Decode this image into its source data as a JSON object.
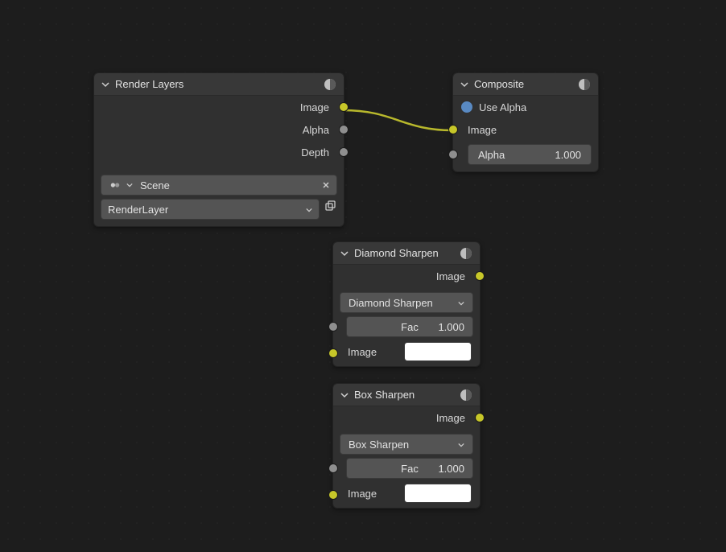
{
  "nodes": {
    "renderLayers": {
      "title": "Render Layers",
      "outputs": {
        "image": "Image",
        "alpha": "Alpha",
        "depth": "Depth"
      },
      "sceneField": "Scene",
      "layerField": "RenderLayer"
    },
    "composite": {
      "title": "Composite",
      "useAlpha": "Use Alpha",
      "inputs": {
        "image": "Image",
        "alpha": "Alpha"
      },
      "alphaValue": "1.000"
    },
    "diamondSharpen": {
      "title": "Diamond Sharpen",
      "outputs": {
        "image": "Image"
      },
      "filterType": "Diamond Sharpen",
      "facLabel": "Fac",
      "facValue": "1.000",
      "inputs": {
        "image": "Image"
      }
    },
    "boxSharpen": {
      "title": "Box Sharpen",
      "outputs": {
        "image": "Image"
      },
      "filterType": "Box Sharpen",
      "facLabel": "Fac",
      "facValue": "1.000",
      "inputs": {
        "image": "Image"
      }
    }
  },
  "connections": [
    {
      "from": "renderLayers.image",
      "to": "composite.image"
    }
  ]
}
